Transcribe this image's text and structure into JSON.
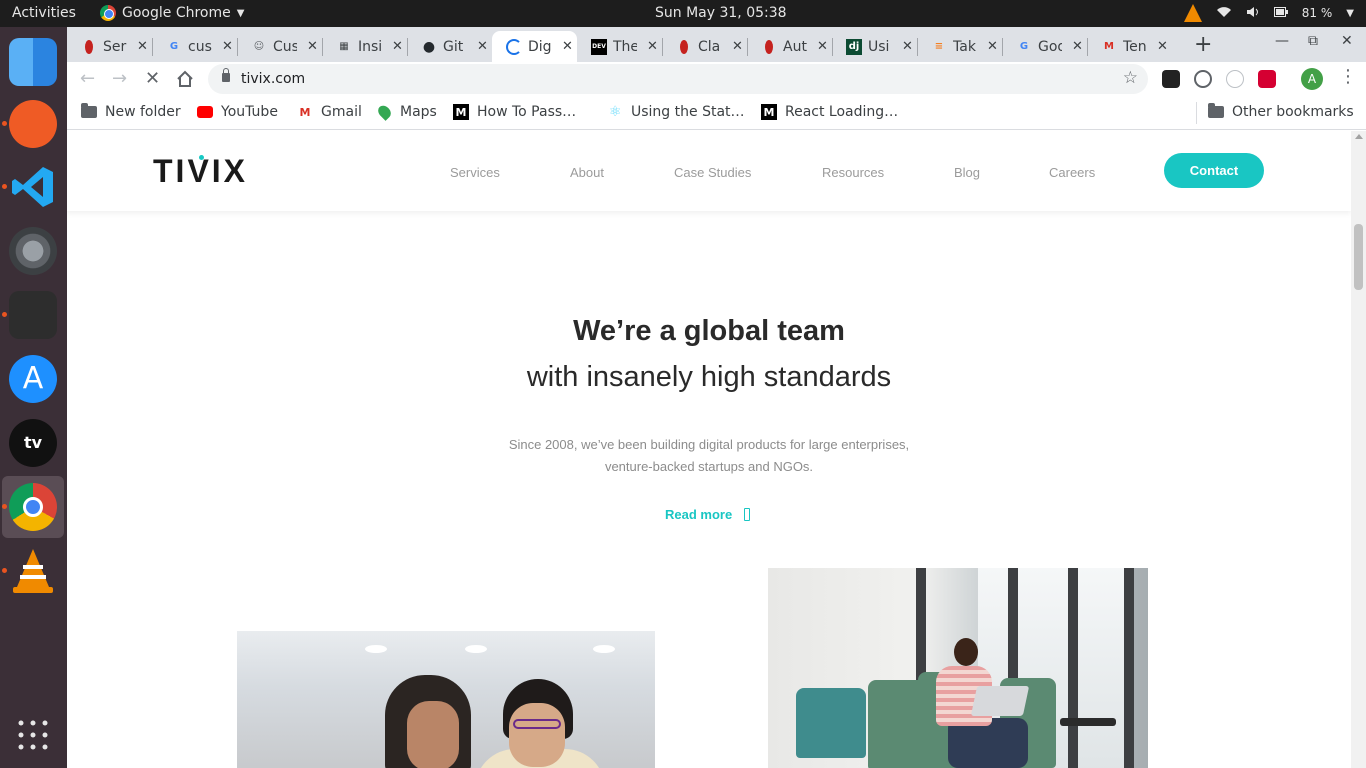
{
  "topbar": {
    "activities": "Activities",
    "app_name": "Google Chrome",
    "clock": "Sun May 31, 05:38",
    "battery": "81 %"
  },
  "tabs": [
    {
      "title": "Ser",
      "favicon": "red-dot-icon",
      "color": "#c5221f"
    },
    {
      "title": "cus",
      "favicon": "google-icon",
      "color": "#4285f4"
    },
    {
      "title": "Cus",
      "favicon": "person-icon",
      "color": "#5f6368"
    },
    {
      "title": "Insi",
      "favicon": "grid-icon",
      "color": "#3c4043"
    },
    {
      "title": "Git",
      "favicon": "github-icon",
      "color": "#24292e"
    },
    {
      "title": "Dig",
      "favicon": "loading-icon",
      "color": "#1a73e8",
      "active": true
    },
    {
      "title": "The",
      "favicon": "dev-icon",
      "color": "#000000"
    },
    {
      "title": "Cla",
      "favicon": "red-dot-icon",
      "color": "#c5221f"
    },
    {
      "title": "Aut",
      "favicon": "red-dot-icon",
      "color": "#c5221f"
    },
    {
      "title": "Usi",
      "favicon": "django-icon",
      "color": "#0c4b33"
    },
    {
      "title": "Tak",
      "favicon": "stackoverflow-icon",
      "color": "#f48024"
    },
    {
      "title": "Goo",
      "favicon": "google-icon",
      "color": "#4285f4"
    },
    {
      "title": "Ten",
      "favicon": "gmail-icon",
      "color": "#d93025"
    }
  ],
  "omnibox": {
    "url": "tivix.com"
  },
  "avatar_letter": "A",
  "bookmarks": [
    {
      "label": "New folder",
      "icon": "folder-icon"
    },
    {
      "label": "YouTube",
      "icon": "youtube-icon"
    },
    {
      "label": "Gmail",
      "icon": "gmail-icon"
    },
    {
      "label": "Maps",
      "icon": "maps-icon"
    },
    {
      "label": "How To Pass…",
      "icon": "medium-icon"
    },
    {
      "label": "Using the Stat…",
      "icon": "react-icon"
    },
    {
      "label": "React Loading…",
      "icon": "medium-icon"
    }
  ],
  "other_bookmarks": "Other bookmarks",
  "site": {
    "logo": "TIVIX",
    "nav": [
      "Services",
      "About",
      "Case Studies",
      "Resources",
      "Blog",
      "Careers"
    ],
    "contact": "Contact",
    "hero_title": "We’re a global team",
    "hero_subtitle": "with insanely high standards",
    "hero_desc_line1": "Since 2008, we’ve been building digital products for large enterprises,",
    "hero_desc_line2": "venture-backed startups and NGOs.",
    "read_more": "Read more"
  },
  "colors": {
    "accent": "#19c6c3",
    "dock_bg": "#3b2f37",
    "topbar_bg": "#1d1d1d"
  }
}
